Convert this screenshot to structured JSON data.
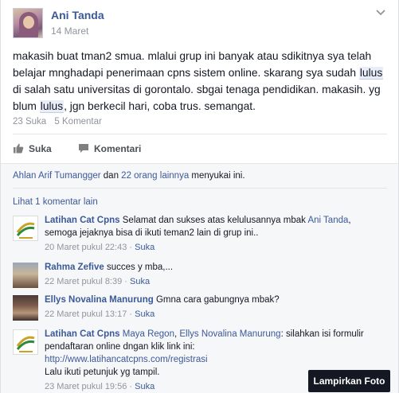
{
  "post": {
    "author": "Ani Tanda",
    "date": "14 Maret",
    "text_parts": {
      "p1": "makasih buat tman2 smua. mlalui grup ini banyak atau sdikitnya sya telah belajar mnghadapi penerimaan cpns sistem online. skarang sya sudah ",
      "hl1": "lulus",
      "p2": " di salah satu universitas di gorontalo. sbgai tenaga pendidikan. makasih. yg blum ",
      "hl2": "lulus",
      "p3": ", jgn berkecil hari, coba trus. semangat."
    },
    "likes_count": "23 Suka",
    "comments_count": "5 Komentar"
  },
  "actions": {
    "like_label": "Suka",
    "comment_label": "Komentari"
  },
  "likes_line": {
    "first_name": "Ahlan Arif Tumangger",
    "connector": " dan ",
    "others": "22 orang lainnya",
    "suffix": " menyukai ini."
  },
  "more_comments": "Lihat 1 komentar lain",
  "comments": [
    {
      "name": "Latihan Cat Cpns",
      "text_a": " Selamat dan sukses atas kelulusannya mbak ",
      "mention": "Ani Tanda",
      "text_b": ",",
      "text_c": "semoga jejaknya bisa di ikuti teman2 lain di grup ini..",
      "time": "20 Maret pukul 22:43",
      "like": "Suka"
    },
    {
      "name": "Rahma Zefive",
      "text": " succes y mba,...",
      "time": "22 Maret pukul 8:39",
      "like": "Suka"
    },
    {
      "name": "Ellys Novalina Manurung",
      "text": " Gmna cara gabungnya mbak?",
      "time": "22 Maret pukul 13:17",
      "like": "Suka"
    },
    {
      "name": "Latihan Cat Cpns",
      "mention1": "Maya Regon",
      "sep": ", ",
      "mention2": "Ellys Novalina Manurung",
      "text_a": ": silahkan isi formulir pendaftaran online dngan klik link ini:",
      "url": "http://www.latihancatcpns.com/registrasi",
      "text_b": "Lalu ikuti petunjuk yg tampil.",
      "time": "23 Maret pukul 19:56",
      "like": "Suka"
    }
  ],
  "attach_label": "Lampirkan Foto",
  "colors": {
    "link": "#3b5998",
    "muted": "#90949c",
    "comments_bg": "#f6f7f9",
    "logo_gold": "#c9a227",
    "logo_green": "#2e8b3a"
  }
}
